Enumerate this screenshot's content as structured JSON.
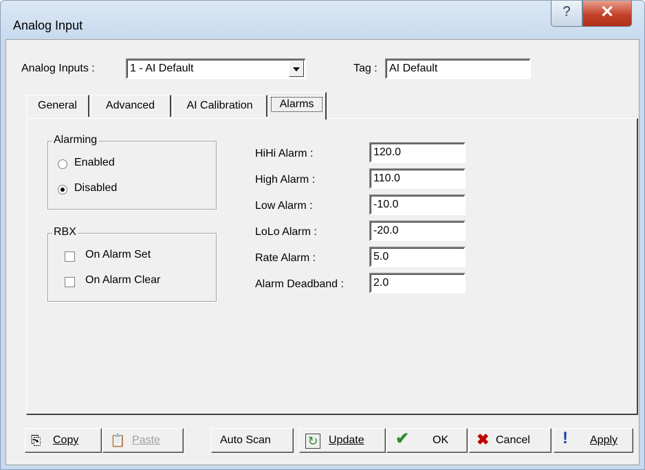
{
  "window": {
    "title": "Analog Input",
    "help_glyph": "?",
    "close_glyph": "✕"
  },
  "header": {
    "analog_inputs_label": "Analog Inputs :",
    "analog_inputs_value": "1 - AI Default",
    "tag_label": "Tag :",
    "tag_value": "AI Default"
  },
  "tabs": [
    {
      "label": "General"
    },
    {
      "label": "Advanced"
    },
    {
      "label": "AI Calibration"
    },
    {
      "label": "Alarms",
      "active": true
    }
  ],
  "alarming": {
    "title": "Alarming",
    "options": [
      {
        "label": "Enabled",
        "checked": false
      },
      {
        "label": "Disabled",
        "checked": true
      }
    ]
  },
  "rbx": {
    "title": "RBX",
    "options": [
      {
        "label": "On Alarm Set",
        "checked": false
      },
      {
        "label": "On Alarm Clear",
        "checked": false
      }
    ]
  },
  "alarm_fields": [
    {
      "label": "HiHi Alarm :",
      "value": "120.0"
    },
    {
      "label": "High Alarm :",
      "value": "110.0"
    },
    {
      "label": "Low Alarm :",
      "value": "-10.0"
    },
    {
      "label": "LoLo Alarm :",
      "value": "-20.0"
    },
    {
      "label": "Rate Alarm :",
      "value": "5.0"
    },
    {
      "label": "Alarm Deadband :",
      "value": "2.0"
    }
  ],
  "buttons": {
    "copy": "Copy",
    "paste": "Paste",
    "auto_scan": "Auto Scan",
    "update": "Update",
    "ok": "OK",
    "cancel": "Cancel",
    "apply": "Apply"
  },
  "colors": {
    "ok_check": "#2e8b2e",
    "cancel_x": "#c00000",
    "apply_bang": "#1a3fa8",
    "update_icon": "#2e8b2e"
  }
}
